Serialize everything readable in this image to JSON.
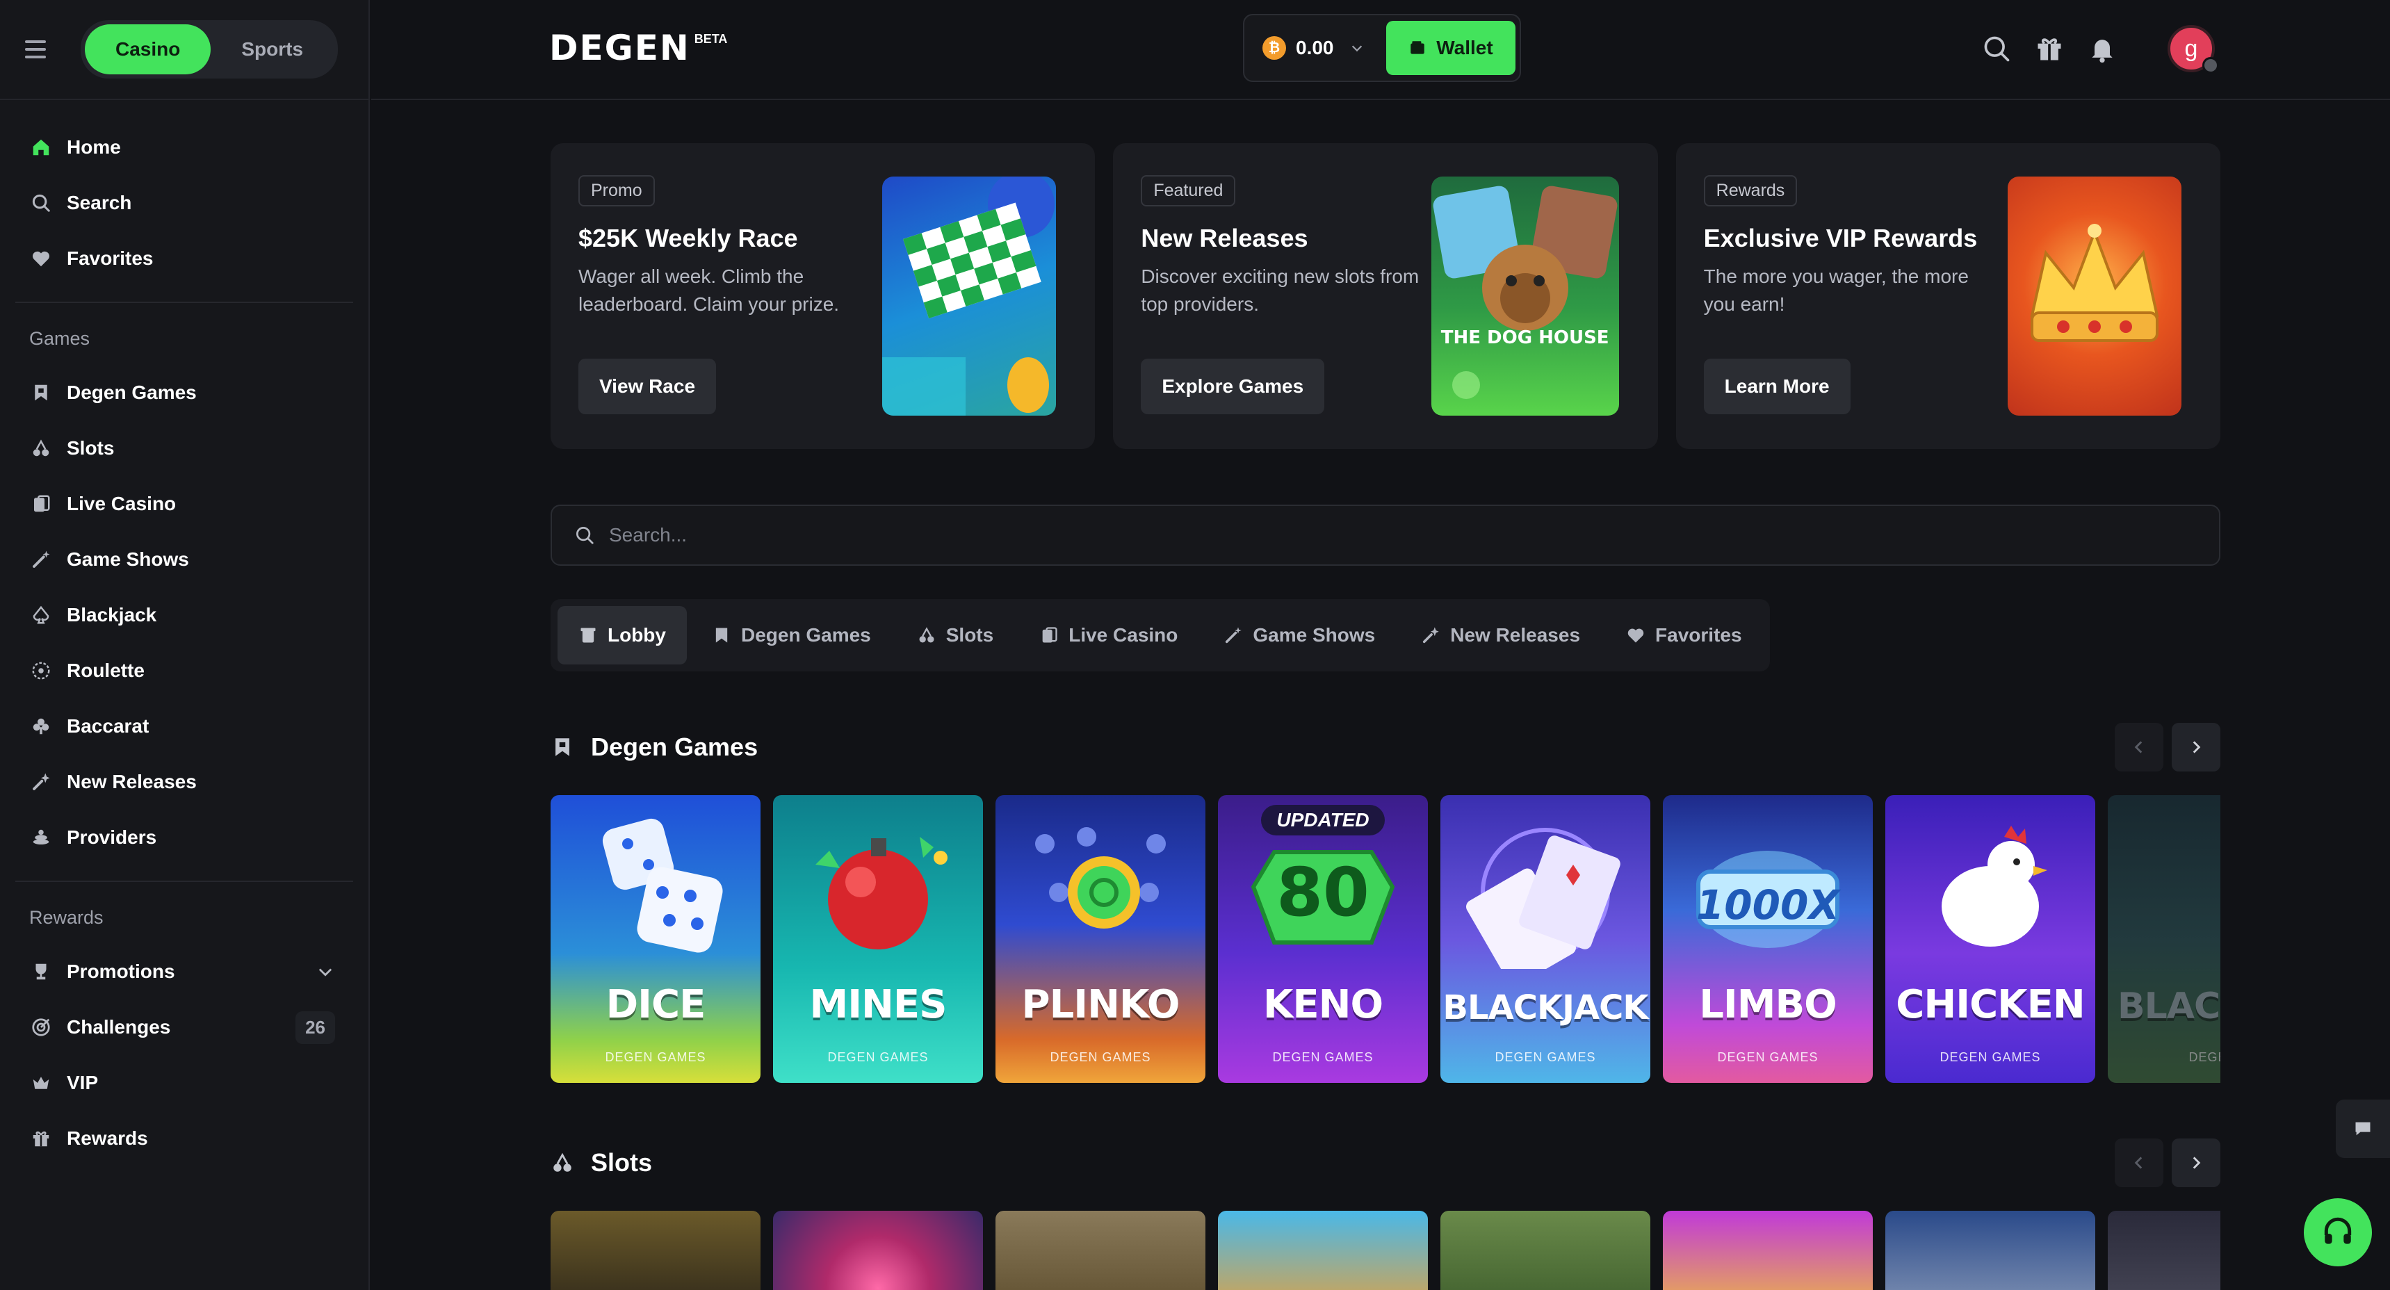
{
  "sidebar": {
    "toggle": {
      "casino": "Casino",
      "sports": "Sports"
    },
    "top_items": [
      {
        "label": "Home",
        "icon": "home-icon"
      },
      {
        "label": "Search",
        "icon": "search-icon"
      },
      {
        "label": "Favorites",
        "icon": "heart-icon"
      }
    ],
    "games_section": "Games",
    "games_items": [
      {
        "label": "Degen Games",
        "icon": "bookmark-icon"
      },
      {
        "label": "Slots",
        "icon": "cherry-icon"
      },
      {
        "label": "Live Casino",
        "icon": "cards-icon"
      },
      {
        "label": "Game Shows",
        "icon": "wand-icon"
      },
      {
        "label": "Blackjack",
        "icon": "spade-icon"
      },
      {
        "label": "Roulette",
        "icon": "roulette-icon"
      },
      {
        "label": "Baccarat",
        "icon": "club-icon"
      },
      {
        "label": "New Releases",
        "icon": "sparkle-icon"
      },
      {
        "label": "Providers",
        "icon": "providers-icon"
      }
    ],
    "rewards_section": "Rewards",
    "rewards_items": [
      {
        "label": "Promotions",
        "icon": "trophy-icon"
      },
      {
        "label": "Challenges",
        "icon": "target-icon",
        "badge": "26"
      },
      {
        "label": "VIP",
        "icon": "crown-icon"
      },
      {
        "label": "Rewards",
        "icon": "gift-icon"
      }
    ]
  },
  "header": {
    "logo": "DEGEN",
    "logo_badge": "BETA",
    "balance": "0.00",
    "coin_symbol": "₿",
    "wallet_label": "Wallet"
  },
  "promos": [
    {
      "tag": "Promo",
      "title": "$25K Weekly Race",
      "desc": "Wager all week. Climb the leaderboard. Claim your prize.",
      "button": "View Race"
    },
    {
      "tag": "Featured",
      "title": "New Releases",
      "desc": "Discover exciting new slots from top providers.",
      "button": "Explore Games"
    },
    {
      "tag": "Rewards",
      "title": "Exclusive VIP Rewards",
      "desc": "The more you wager, the more you earn!",
      "button": "Learn More"
    }
  ],
  "search": {
    "placeholder": "Search..."
  },
  "tabs": [
    "Lobby",
    "Degen Games",
    "Slots",
    "Live Casino",
    "Game Shows",
    "New Releases",
    "Favorites"
  ],
  "rows": {
    "degen_title": "Degen Games",
    "slots_title": "Slots"
  },
  "degen_games": [
    {
      "name": "DICE",
      "sub": "DEGEN GAMES"
    },
    {
      "name": "MINES",
      "sub": "DEGEN GAMES"
    },
    {
      "name": "PLINKO",
      "sub": "DEGEN GAMES"
    },
    {
      "name": "KENO",
      "sub": "DEGEN GAMES",
      "badge": "UPDATED"
    },
    {
      "name": "BLACKJACK",
      "sub": "DEGEN GAMES"
    },
    {
      "name": "LIMBO",
      "sub": "DEGEN GAMES"
    },
    {
      "name": "CHICKEN",
      "sub": "DEGEN GAMES"
    },
    {
      "name": "BLACK",
      "sub": "DEGEN"
    }
  ],
  "promo_art_text": {
    "dog_house": "THE DOG HOUSE",
    "keno_number": "80",
    "limbo_multiplier": "1000X"
  },
  "colors": {
    "accent": "#43e35c",
    "bg": "#111216",
    "panel": "#1b1c21"
  }
}
